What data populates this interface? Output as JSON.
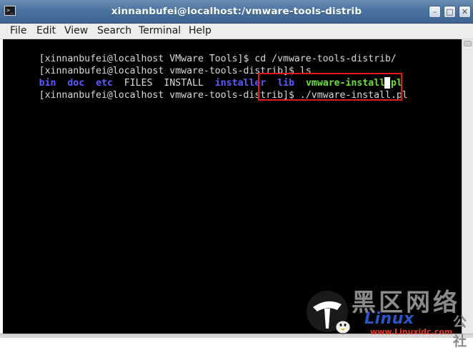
{
  "window": {
    "title": "xinnanbufei@localhost:/vmware-tools-distrib",
    "app_icon_glyph": ">_",
    "controls": {
      "minimize": "–",
      "maximize": "□",
      "close": "✕"
    }
  },
  "menubar": {
    "items": [
      "File",
      "Edit",
      "View",
      "Search",
      "Terminal",
      "Help"
    ]
  },
  "terminal": {
    "lines": [
      {
        "prompt": "[xinnanbufei@localhost VMware Tools]$ ",
        "command": "cd /vmware-tools-distrib/"
      },
      {
        "prompt": "[xinnanbufei@localhost vmware-tools-distrib]$ ",
        "command": "ls"
      },
      {
        "prompt": "[xinnanbufei@localhost vmware-tools-distrib]$ ",
        "command": "./vmware-install.pl "
      }
    ],
    "ls_output": [
      {
        "name": "bin",
        "type": "directory"
      },
      {
        "name": "doc",
        "type": "directory"
      },
      {
        "name": "etc",
        "type": "directory"
      },
      {
        "name": "FILES",
        "type": "file"
      },
      {
        "name": "INSTALL",
        "type": "file"
      },
      {
        "name": "installer",
        "type": "directory"
      },
      {
        "name": "lib",
        "type": "directory"
      },
      {
        "name": "vmware-install.pl",
        "type": "executable"
      }
    ],
    "colors": {
      "background": "#000000",
      "foreground": "#d9d9d9",
      "directory": "#5b5bff",
      "executable": "#6edc3c",
      "highlight_box": "#e11b1b"
    }
  },
  "watermark": {
    "chinese_text": "黑区网络",
    "brand": "Linux",
    "suffix": "公社",
    "url": "www.Linuxidc.com"
  }
}
